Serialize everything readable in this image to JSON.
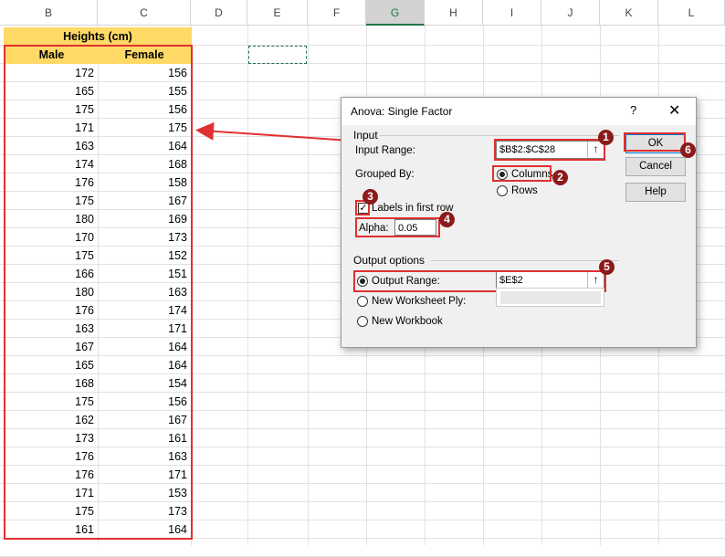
{
  "columns": [
    "B",
    "C",
    "D",
    "E",
    "F",
    "G",
    "H",
    "I",
    "J",
    "K",
    "L"
  ],
  "table": {
    "title": "Heights (cm)",
    "headers": [
      "Male",
      "Female"
    ],
    "rows": [
      [
        172,
        156
      ],
      [
        165,
        155
      ],
      [
        175,
        156
      ],
      [
        171,
        175
      ],
      [
        163,
        164
      ],
      [
        174,
        168
      ],
      [
        176,
        158
      ],
      [
        175,
        167
      ],
      [
        180,
        169
      ],
      [
        170,
        173
      ],
      [
        175,
        152
      ],
      [
        166,
        151
      ],
      [
        180,
        163
      ],
      [
        176,
        174
      ],
      [
        163,
        171
      ],
      [
        167,
        164
      ],
      [
        165,
        164
      ],
      [
        168,
        154
      ],
      [
        175,
        156
      ],
      [
        162,
        167
      ],
      [
        173,
        161
      ],
      [
        176,
        163
      ],
      [
        176,
        171
      ],
      [
        171,
        153
      ],
      [
        175,
        173
      ],
      [
        161,
        164
      ]
    ]
  },
  "dialog": {
    "title": "Anova: Single Factor",
    "help_label": "?",
    "close_label": "✕",
    "input_group": "Input",
    "input_range_label": "Input Range:",
    "input_range_value": "$B$2:$C$28",
    "grouped_by_label": "Grouped By:",
    "columns_label": "Columns",
    "rows_label": "Rows",
    "labels_first_row_label": "Labels in first row",
    "alpha_label": "Alpha:",
    "alpha_value": "0.05",
    "output_group": "Output options",
    "output_range_label": "Output Range:",
    "output_range_value": "$E$2",
    "new_worksheet_label": "New Worksheet Ply:",
    "new_workbook_label": "New Workbook",
    "ok_label": "OK",
    "cancel_label": "Cancel",
    "help_button_label": "Help",
    "ref_icon": "↑"
  },
  "badges": [
    "1",
    "2",
    "3",
    "4",
    "5",
    "6"
  ],
  "colors": {
    "highlight": "#e03030",
    "header_fill": "#ffd966",
    "badge": "#8b1a1a",
    "selection": "#217346"
  }
}
